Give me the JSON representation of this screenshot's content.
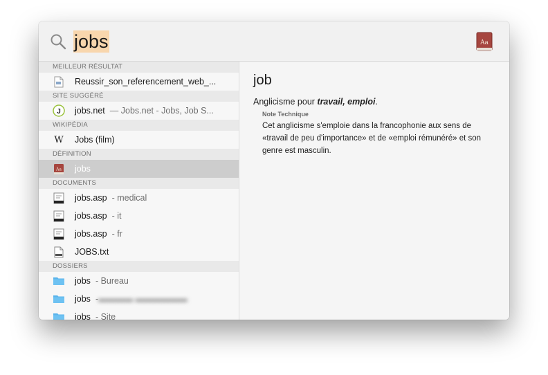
{
  "search": {
    "query": "jobs"
  },
  "results": {
    "sections": [
      {
        "header": "MEILLEUR RÉSULTAT",
        "items": [
          {
            "title": "Reussir_son_referencement_web_...",
            "sub": ""
          }
        ]
      },
      {
        "header": "SITE SUGGÉRÉ",
        "items": [
          {
            "title": "jobs.net",
            "sub": "— Jobs.net - Jobs, Job S..."
          }
        ]
      },
      {
        "header": "WIKIPÉDIA",
        "items": [
          {
            "title": "Jobs (film)",
            "sub": ""
          }
        ]
      },
      {
        "header": "DÉFINITION",
        "items": [
          {
            "title": "jobs",
            "sub": "",
            "selected": true
          }
        ]
      },
      {
        "header": "DOCUMENTS",
        "items": [
          {
            "title": "jobs.asp",
            "sub": "- medical"
          },
          {
            "title": "jobs.asp",
            "sub": "- it"
          },
          {
            "title": "jobs.asp",
            "sub": "- fr"
          },
          {
            "title": "JOBS.txt",
            "sub": ""
          }
        ]
      },
      {
        "header": "DOSSIERS",
        "items": [
          {
            "title": "jobs",
            "sub": "- Bureau"
          },
          {
            "title": "jobs",
            "sub": "- "
          },
          {
            "title": "jobs",
            "sub": "- Site"
          }
        ]
      }
    ]
  },
  "definition": {
    "word": "job",
    "line_prefix": "Anglicisme pour ",
    "line_emphasis": "travail, emploi",
    "line_suffix": ".",
    "note_title": "Note Technique",
    "note_text": "Cet anglicisme s'emploie dans la francophonie aux sens de «travail de peu d'importance» et de «emploi rémunéré» et son genre est masculin."
  },
  "colors": {
    "query_highlight": "#f8d6ad",
    "selected_row": "#cdcdcd",
    "folder": "#5ab4ec",
    "dictionary": "#a6463f"
  },
  "icons": {
    "search": "search-icon",
    "dictionary_app": "dictionary-app-icon",
    "pdf": "pdf-document-icon",
    "site": "website-favicon",
    "wikipedia": "wikipedia-icon",
    "definition": "dictionary-icon",
    "asp": "document-icon",
    "txt": "text-file-icon",
    "folder": "folder-icon"
  }
}
